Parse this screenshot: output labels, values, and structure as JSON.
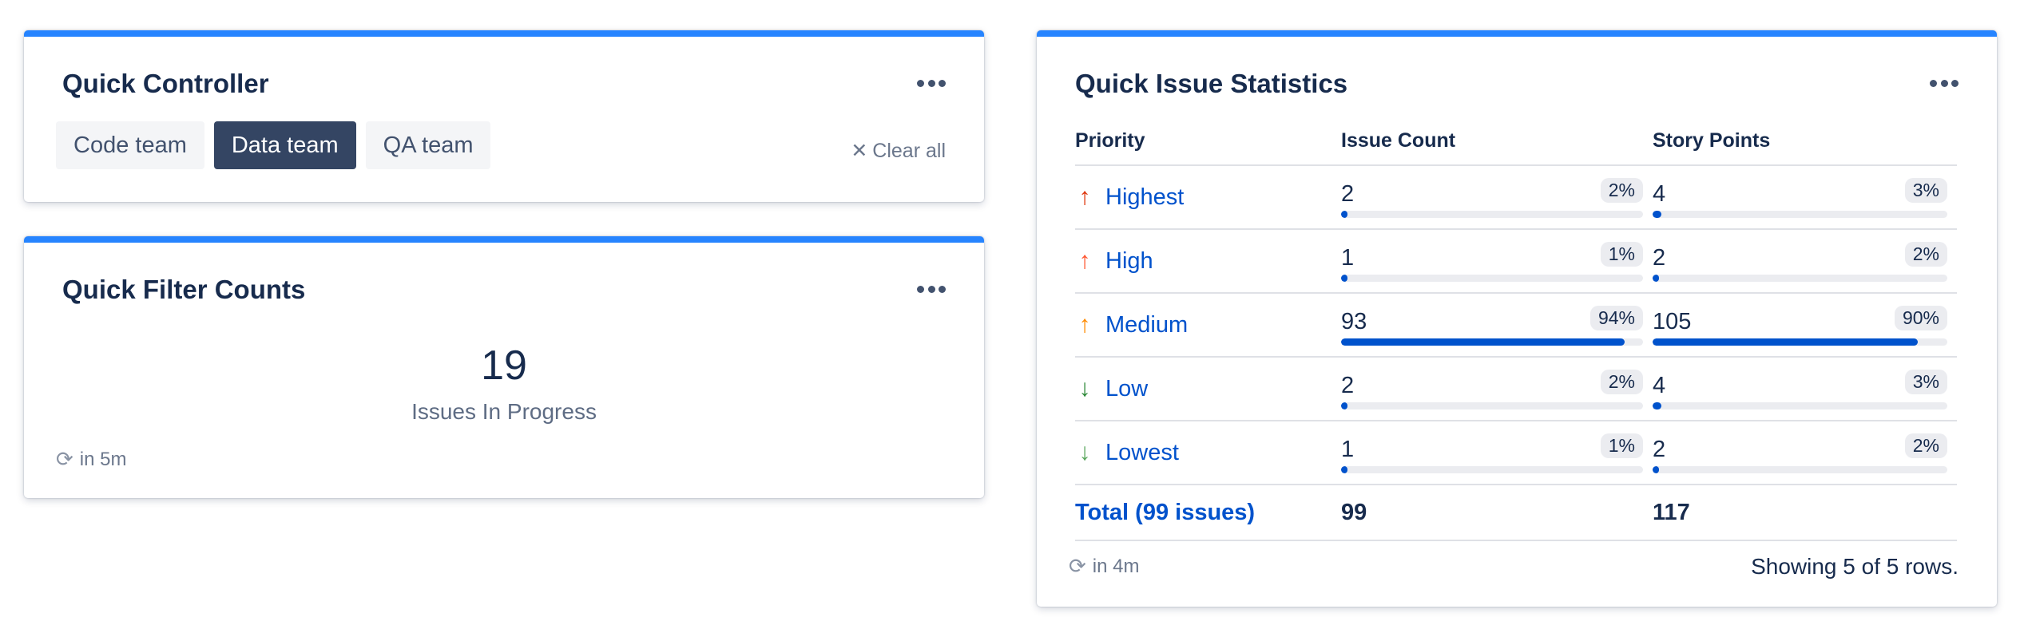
{
  "quick_controller": {
    "title": "Quick Controller",
    "chips": [
      {
        "label": "Code team",
        "active": false
      },
      {
        "label": "Data team",
        "active": true
      },
      {
        "label": "QA team",
        "active": false
      }
    ],
    "clear_all": "Clear all"
  },
  "quick_filter": {
    "title": "Quick Filter Counts",
    "count": "19",
    "label": "Issues In Progress",
    "refresh": "in 5m"
  },
  "quick_stats": {
    "title": "Quick Issue Statistics",
    "headers": {
      "priority": "Priority",
      "issue_count": "Issue Count",
      "story_points": "Story Points"
    },
    "rows": [
      {
        "priority": "Highest",
        "arrow": "up",
        "color": "#de350b",
        "count": "2",
        "count_pct": "2%",
        "count_frac": 0.02,
        "points": "4",
        "points_pct": "3%",
        "points_frac": 0.03
      },
      {
        "priority": "High",
        "arrow": "up",
        "color": "#ff5630",
        "count": "1",
        "count_pct": "1%",
        "count_frac": 0.01,
        "points": "2",
        "points_pct": "2%",
        "points_frac": 0.02
      },
      {
        "priority": "Medium",
        "arrow": "up",
        "color": "#ff8b00",
        "count": "93",
        "count_pct": "94%",
        "count_frac": 0.94,
        "points": "105",
        "points_pct": "90%",
        "points_frac": 0.9
      },
      {
        "priority": "Low",
        "arrow": "down",
        "color": "#2a8735",
        "count": "2",
        "count_pct": "2%",
        "count_frac": 0.02,
        "points": "4",
        "points_pct": "3%",
        "points_frac": 0.03
      },
      {
        "priority": "Lowest",
        "arrow": "down",
        "color": "#57a55a",
        "count": "1",
        "count_pct": "1%",
        "count_frac": 0.01,
        "points": "2",
        "points_pct": "2%",
        "points_frac": 0.02
      }
    ],
    "total": {
      "label": "Total (99 issues)",
      "count": "99",
      "points": "117"
    },
    "refresh": "in 4m",
    "showing": "Showing 5 of 5 rows."
  }
}
